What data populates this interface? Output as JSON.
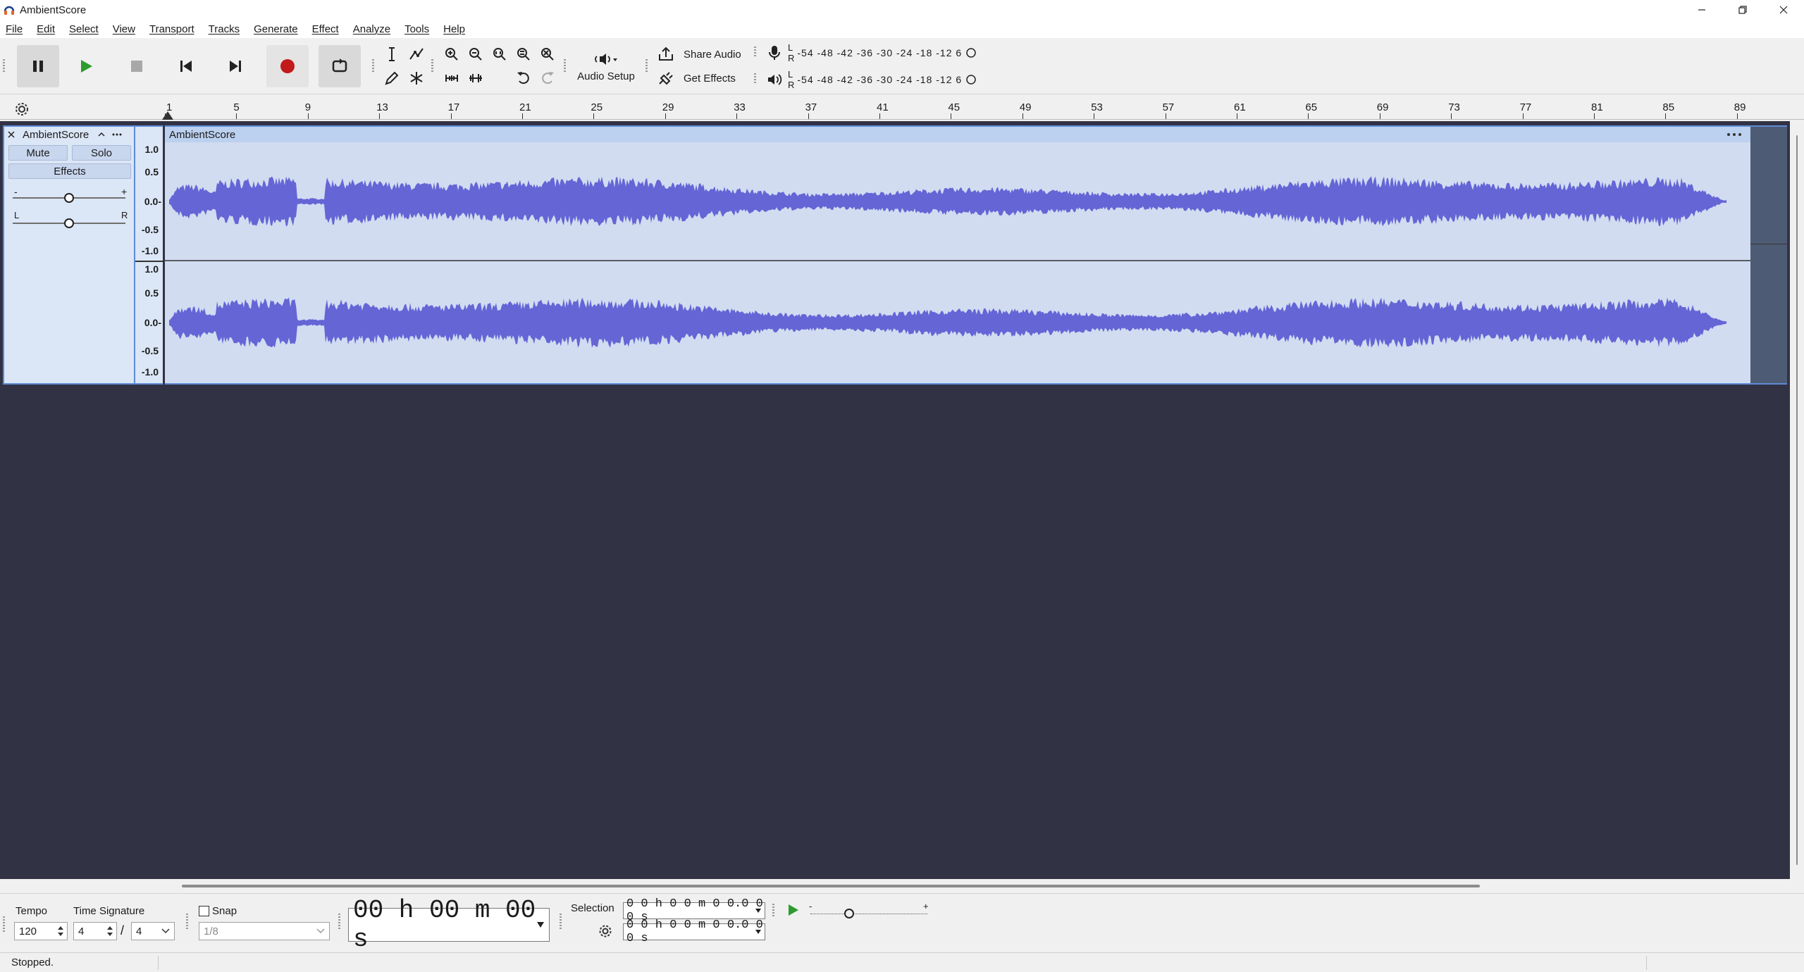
{
  "app": {
    "title": "AmbientScore"
  },
  "menu": [
    "File",
    "Edit",
    "Select",
    "View",
    "Transport",
    "Tracks",
    "Generate",
    "Effect",
    "Analyze",
    "Tools",
    "Help"
  ],
  "toolbar": {
    "audio_setup_label": "Audio Setup",
    "share_audio_label": "Share Audio",
    "get_effects_label": "Get Effects",
    "record_meter": {
      "l": "L",
      "r": "R",
      "scale": "-54 -48 -42 -36 -30 -24 -18 -12 6"
    },
    "play_meter": {
      "l": "L",
      "r": "R",
      "scale": "-54 -48 -42 -36 -30 -24 -18 -12 6"
    }
  },
  "ruler": {
    "ticks": [
      "1",
      "5",
      "9",
      "13",
      "17",
      "21",
      "25",
      "29",
      "33",
      "37",
      "41",
      "45",
      "49",
      "53",
      "57",
      "61",
      "65",
      "69",
      "73",
      "77",
      "81",
      "85",
      "89"
    ]
  },
  "track": {
    "name": "AmbientScore",
    "mute": "Mute",
    "solo": "Solo",
    "effects": "Effects",
    "gain_minus": "-",
    "gain_plus": "+",
    "pan_left": "L",
    "pan_right": "R",
    "gain_level": 0.5,
    "pan_level": 0.5,
    "clip_name": "AmbientScore",
    "scale_labels": [
      "1.0",
      "0.5",
      "0.0-",
      "-0.5",
      "-1.0"
    ]
  },
  "colors": {
    "waveform": "#6565d6",
    "canvas": "#323245",
    "clip_bg": "#d1dcf1",
    "record": "#c2191b",
    "play": "#2d9c2d"
  },
  "bottom": {
    "tempo_label": "Tempo",
    "tempo_value": "120",
    "timesig_label": "Time Signature",
    "timesig_num": "4",
    "timesig_sep": "/",
    "timesig_den": "4",
    "snap_label": "Snap",
    "snap_value": "1/8",
    "time_display": "00 h 00 m 00 s",
    "selection_label": "Selection",
    "selection_start": "0 0 h 0 0 m 0 0.0 0 0 s",
    "selection_end": "0 0 h 0 0 m 0 0.0 0 0 s",
    "speed_minus": "-",
    "speed_plus": "+"
  },
  "status": {
    "text": "Stopped."
  }
}
